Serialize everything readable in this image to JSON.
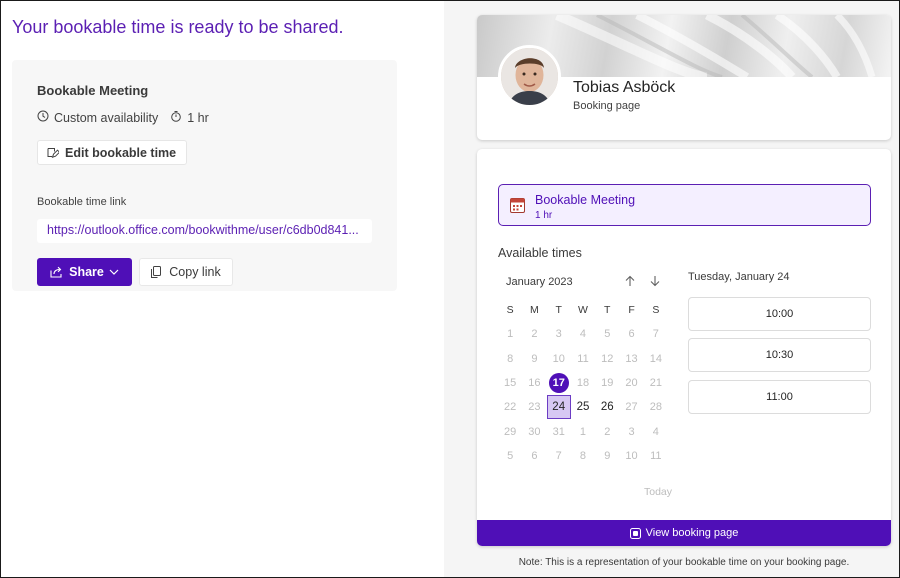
{
  "left": {
    "headline": "Your bookable time is ready to be shared.",
    "meeting_title": "Bookable Meeting",
    "availability": "Custom availability",
    "duration": "1 hr",
    "edit_label": "Edit bookable time",
    "link_label": "Bookable time link",
    "link_value": "https://outlook.office.com/bookwithme/user/c6db0d841...",
    "share_label": "Share",
    "copy_label": "Copy link"
  },
  "profile": {
    "name": "Tobias Asböck",
    "subtitle": "Booking page"
  },
  "booking": {
    "meeting_title": "Bookable Meeting",
    "meeting_duration": "1 hr",
    "available_label": "Available times",
    "month": "January 2023",
    "weekdays": [
      "S",
      "M",
      "T",
      "W",
      "T",
      "F",
      "S"
    ],
    "weeks": [
      [
        "1",
        "2",
        "3",
        "4",
        "5",
        "6",
        "7"
      ],
      [
        "8",
        "9",
        "10",
        "11",
        "12",
        "13",
        "14"
      ],
      [
        "15",
        "16",
        "17",
        "18",
        "19",
        "20",
        "21"
      ],
      [
        "22",
        "23",
        "24",
        "25",
        "26",
        "27",
        "28"
      ],
      [
        "29",
        "30",
        "31",
        "1",
        "2",
        "3",
        "4"
      ],
      [
        "5",
        "6",
        "7",
        "8",
        "9",
        "10",
        "11"
      ]
    ],
    "today_day": "17",
    "selected_day": "24",
    "available_days": [
      "25",
      "26"
    ],
    "today_label": "Today",
    "date_label": "Tuesday, January 24",
    "slots": [
      "10:00",
      "10:30",
      "11:00"
    ],
    "view_label": "View booking page",
    "note": "Note: This is a representation of your bookable time on your booking page."
  },
  "colors": {
    "brand": "#4f0fb7",
    "headline": "#5b1fb3",
    "selected_day_bg": "#d7c8f3"
  }
}
